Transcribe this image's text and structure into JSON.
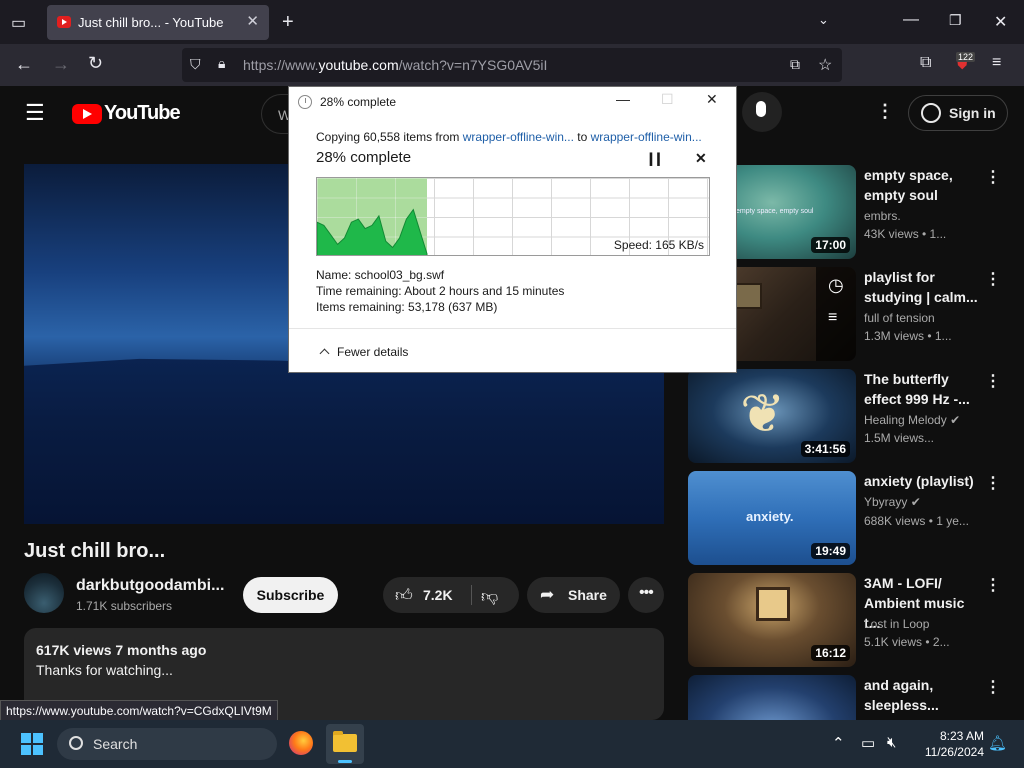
{
  "browser": {
    "tab_title": "Just chill bro... - YouTube",
    "url_prefix": "https://www.",
    "url_domain": "youtube.com",
    "url_path": "/watch?v=n7YSG0AV5iI",
    "extension_badge": "122",
    "status_link": "https://www.youtube.com/watch?v=CGdxQLIVt9M"
  },
  "youtube": {
    "logo_text": "YouTube",
    "search_stub": "W",
    "sign_in": "Sign in",
    "video": {
      "title": "Just chill bro...",
      "channel": "darkbutgoodambi...",
      "subscribers": "1.71K subscribers",
      "subscribe_label": "Subscribe",
      "likes": "7.2K",
      "share_label": "Share",
      "views_date": "617K views  7 months ago",
      "description": "Thanks for watching..."
    },
    "recommendations": [
      {
        "title": "empty space, empty soul",
        "channel": "embrs.",
        "views": "43K views  • 1...",
        "duration": "17:00",
        "thumb_text": "empty space, empty soul",
        "color": "#3e8a82"
      },
      {
        "title": "playlist for studying | calm...",
        "channel": "full of tension",
        "views": "1.3M views  • 1...",
        "duration": "",
        "color": "#3a2e22"
      },
      {
        "title": "The butterfly effect 999 Hz -...",
        "channel": "Healing Melody",
        "views": "1.5M views...",
        "duration": "3:41:56",
        "color": "#1c3a5c"
      },
      {
        "title": "anxiety (playlist)",
        "channel": "Ybyrayy",
        "views": "688K views  • 1 ye...",
        "duration": "19:49",
        "thumb_text": "anxiety.",
        "color": "#2f6fb8"
      },
      {
        "title": "3AM - LOFI/ Ambient music t...",
        "channel": "Lost in Loop",
        "views": "5.1K views  • 2...",
        "duration": "16:12",
        "color": "#4a3a28"
      },
      {
        "title": "and again, sleepless...",
        "channel": "",
        "views": "",
        "duration": "",
        "color": "#23406e"
      }
    ]
  },
  "dialog": {
    "window_title": "28% complete",
    "copy_prefix": "Copying 60,558 items from ",
    "source": "wrapper-offline-win...",
    "to_word": " to ",
    "dest": "wrapper-offline-win...",
    "percent_label": "28% complete",
    "progress_fraction": 0.28,
    "speed": "Speed: 165 KB/s",
    "name_line": "Name:  school03_bg.swf",
    "time_line": "Time remaining:  About 2 hours and 15 minutes",
    "items_line": "Items remaining:  53,178 (637 MB)",
    "fewer_details": "Fewer details"
  },
  "taskbar": {
    "search_label": "Search",
    "time": "8:23 AM",
    "date": "11/26/2024"
  }
}
